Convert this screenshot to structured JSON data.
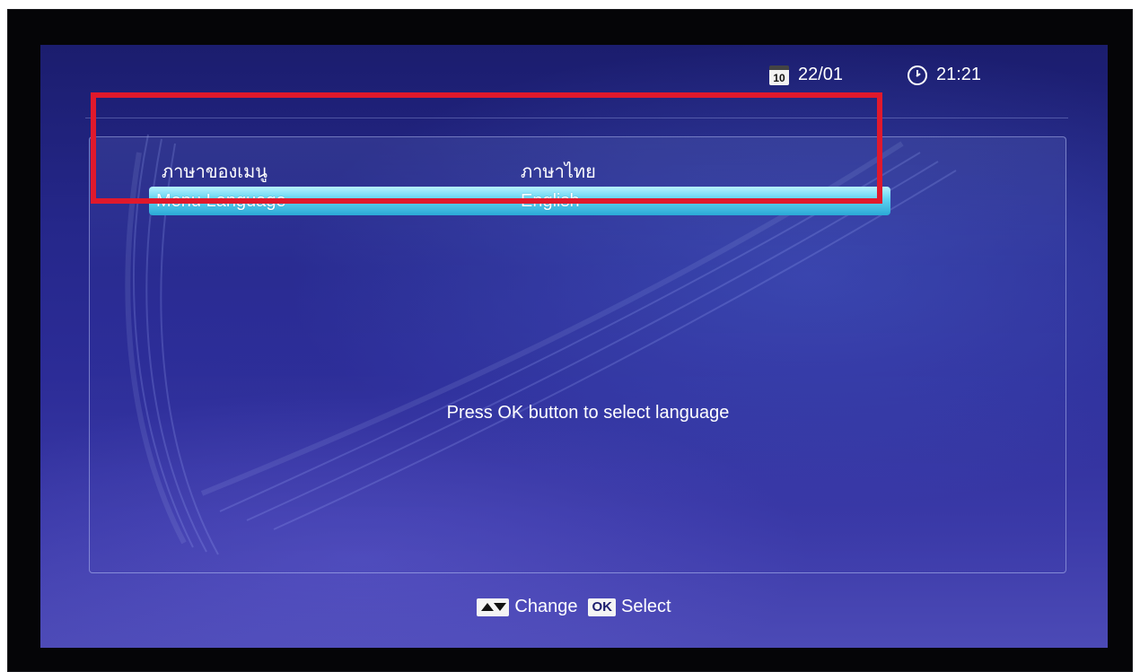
{
  "status": {
    "date_icon": "calendar-icon",
    "date_icon_text": "10",
    "date": "22/01",
    "time_icon": "clock-icon",
    "time": "21:21"
  },
  "menu": {
    "rows": [
      {
        "label": "ภาษาของเมนู",
        "value": "ภาษาไทย",
        "selected": false
      },
      {
        "label": "Menu Language",
        "value": "English",
        "selected": true
      }
    ]
  },
  "prompt": "Press OK button to select language",
  "footer": {
    "change_icon": "up-down-arrows-icon",
    "change_label": "Change",
    "select_key": "OK",
    "select_label": "Select"
  },
  "colors": {
    "background": "#25278a",
    "selection": "#5fd2f0",
    "annotation_box": "#e0192c"
  }
}
